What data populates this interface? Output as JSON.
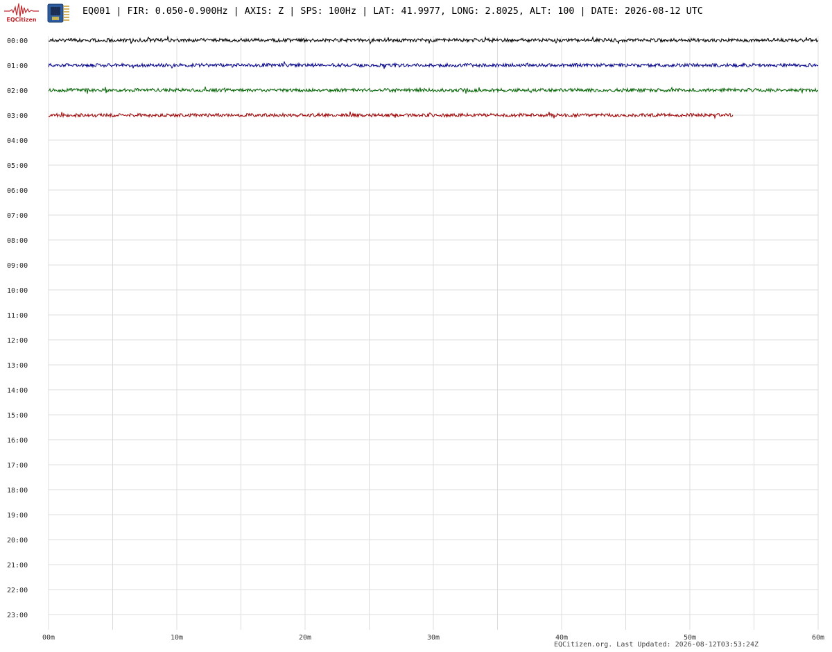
{
  "header": {
    "logo_text": "EQCitizen",
    "title": "EQ001 | FIR: 0.050-0.900Hz | AXIS: Z | SPS: 100Hz | LAT: 41.9977, LONG: 2.8025, ALT: 100 | DATE: 2026-08-12 UTC"
  },
  "footer": {
    "text": "EQCitizen.org. Last Updated: 2026-08-12T03:53:24Z"
  },
  "icons": {
    "logo": "seismograph-logo-icon",
    "board": "microcontroller-board-icon"
  },
  "chart_data": {
    "type": "line",
    "title": "",
    "xlabel": "",
    "ylabel": "",
    "row_labels": [
      "00:00",
      "01:00",
      "02:00",
      "03:00",
      "04:00",
      "05:00",
      "06:00",
      "07:00",
      "08:00",
      "09:00",
      "10:00",
      "11:00",
      "12:00",
      "13:00",
      "14:00",
      "15:00",
      "16:00",
      "17:00",
      "18:00",
      "19:00",
      "20:00",
      "21:00",
      "22:00",
      "23:00"
    ],
    "x_ticks": [
      "00m",
      "10m",
      "20m",
      "30m",
      "40m",
      "50m",
      "60m"
    ],
    "xlim": [
      0,
      60
    ],
    "grid": true,
    "series": [
      {
        "row": "00:00",
        "color": "#000000",
        "start_min": 0,
        "end_min": 60
      },
      {
        "row": "01:00",
        "color": "#00008b",
        "start_min": 0,
        "end_min": 60
      },
      {
        "row": "02:00",
        "color": "#006400",
        "start_min": 0,
        "end_min": 60
      },
      {
        "row": "03:00",
        "color": "#a00000",
        "start_min": 0,
        "end_min": 53.4
      }
    ]
  }
}
